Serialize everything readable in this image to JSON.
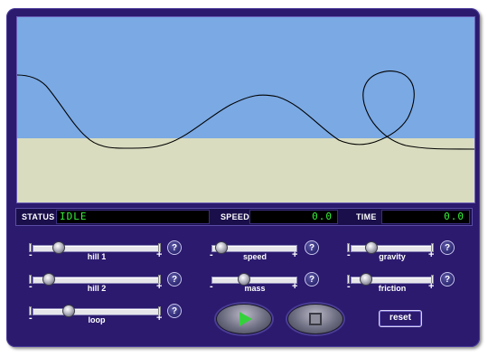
{
  "status": {
    "status_label": "STATUS",
    "status_value": "IDLE",
    "speed_label": "SPEED",
    "speed_value": "0.0",
    "time_label": "TIME",
    "time_value": "0.0"
  },
  "sliders": {
    "hill1": {
      "label": "hill 1",
      "minus": "-",
      "plus": "+",
      "value": 0.18
    },
    "hill2": {
      "label": "hill 2",
      "minus": "-",
      "plus": "+",
      "value": 0.09
    },
    "loop": {
      "label": "loop",
      "minus": "-",
      "plus": "+",
      "value": 0.27
    },
    "speed": {
      "label": "speed",
      "minus": "-",
      "plus": "+",
      "value": 0.05
    },
    "mass": {
      "label": "mass",
      "minus": "-",
      "plus": "+",
      "value": 0.37
    },
    "gravity": {
      "label": "gravity",
      "minus": "-",
      "plus": "+",
      "value": 0.22
    },
    "friction": {
      "label": "friction",
      "minus": "-",
      "plus": "+",
      "value": 0.14
    }
  },
  "help_label": "?",
  "controls": {
    "play_icon": "play-icon",
    "stop_icon": "stop-icon",
    "reset_label": "reset"
  },
  "colors": {
    "panel": "#2b1a6e",
    "sky": "#7aa9e4",
    "ground": "#d9dcbf",
    "digital_text": "#36f23b"
  }
}
